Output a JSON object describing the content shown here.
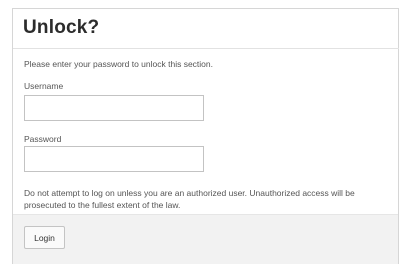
{
  "dialog": {
    "title": "Unlock?",
    "intro": "Please enter your password to unlock this section.",
    "username": {
      "label": "Username",
      "value": "",
      "placeholder": ""
    },
    "password": {
      "label": "Password",
      "value": "",
      "placeholder": ""
    },
    "warning": "Do not attempt to log on unless you are an authorized user. Unauthorized access will be prosecuted to the fullest extent of the law.",
    "login_label": "Login"
  }
}
